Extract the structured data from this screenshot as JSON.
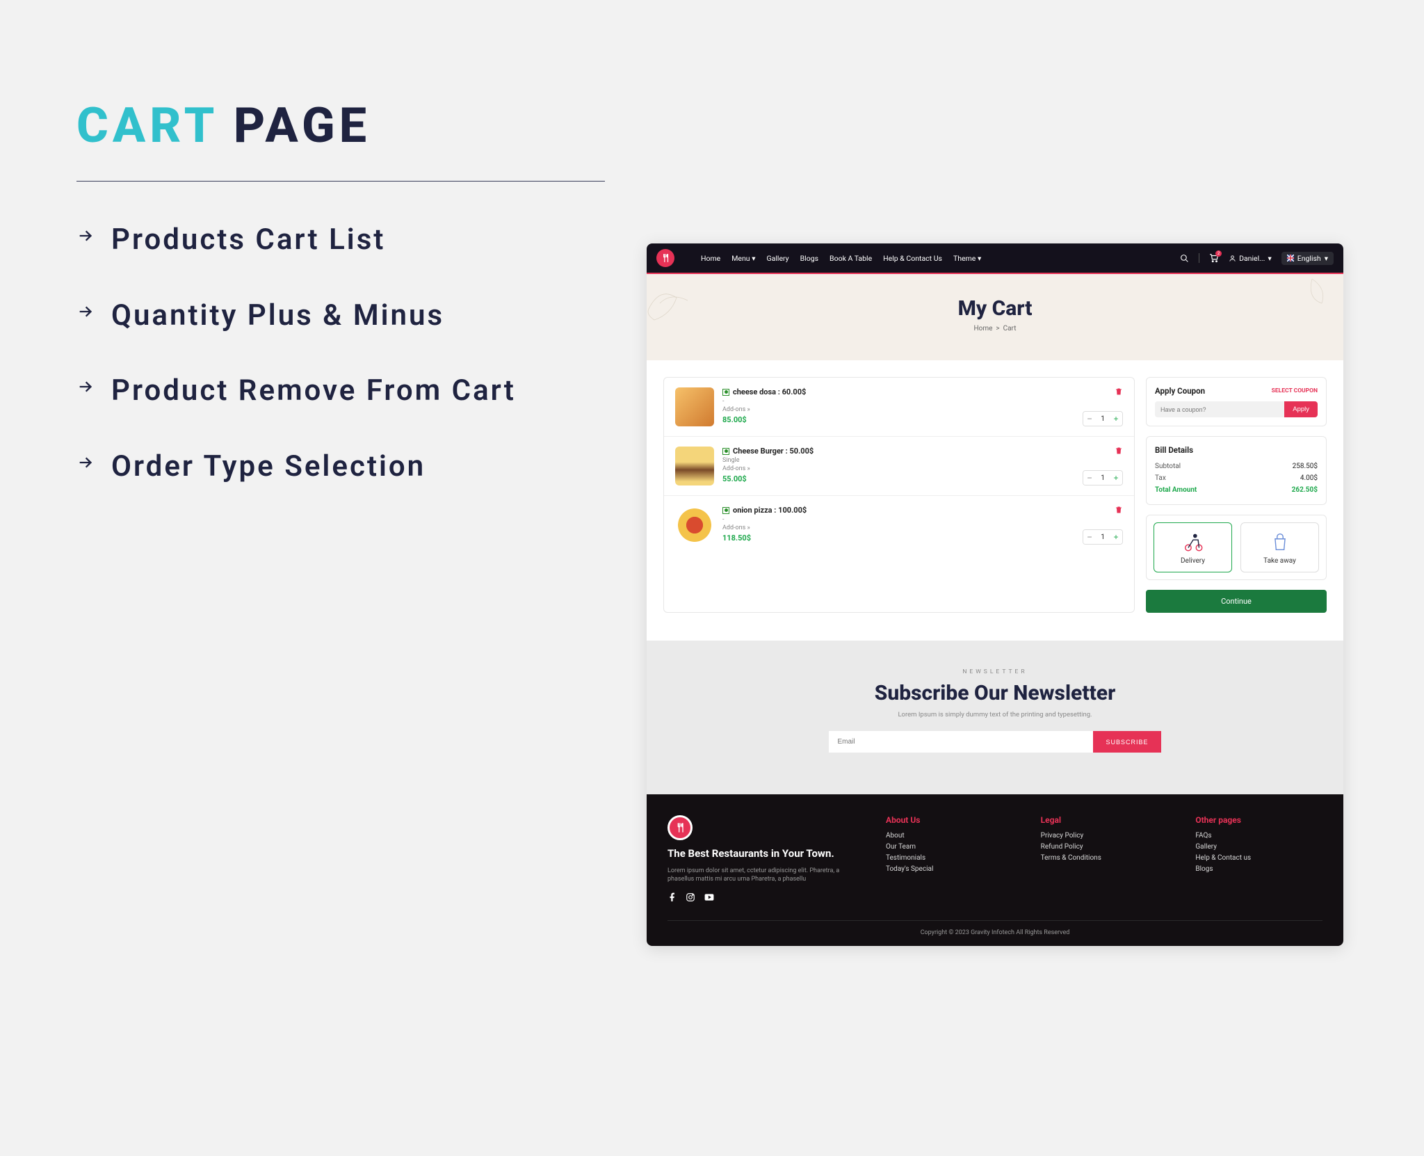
{
  "left": {
    "title_accent": "CART",
    "title_rest": "PAGE",
    "features": [
      "Products Cart List",
      "Quantity Plus & Minus",
      "Product Remove From Cart",
      "Order Type Selection"
    ]
  },
  "nav": {
    "links": [
      "Home",
      "Menu",
      "Gallery",
      "Blogs",
      "Book A Table",
      "Help & Contact Us",
      "Theme"
    ],
    "user": "Daniel...",
    "language": "English",
    "cart_count": "2"
  },
  "hero": {
    "title": "My Cart",
    "breadcrumb_home": "Home",
    "breadcrumb_current": "Cart"
  },
  "cart": {
    "items": [
      {
        "name": "cheese dosa : 60.00$",
        "sub": "-",
        "addon": "Add-ons  »",
        "price": "85.00$",
        "qty": "1"
      },
      {
        "name": "Cheese Burger : 50.00$",
        "sub": "Single",
        "addon": "Add-ons  »",
        "price": "55.00$",
        "qty": "1"
      },
      {
        "name": "onion pizza : 100.00$",
        "sub": "-",
        "addon": "Add-ons  »",
        "price": "118.50$",
        "qty": "1"
      }
    ]
  },
  "coupon": {
    "title": "Apply Coupon",
    "select": "SELECT COUPON",
    "placeholder": "Have a coupon?",
    "apply": "Apply"
  },
  "bill": {
    "title": "Bill Details",
    "rows": [
      {
        "label": "Subtotal",
        "value": "258.50$"
      },
      {
        "label": "Tax",
        "value": "4.00$"
      }
    ],
    "total_label": "Total Amount",
    "total_value": "262.50$"
  },
  "order_types": {
    "delivery": "Delivery",
    "takeaway": "Take away"
  },
  "continue": "Continue",
  "newsletter": {
    "label": "NEWSLETTER",
    "title": "Subscribe Our Newsletter",
    "sub": "Lorem Ipsum is simply dummy text of the printing and typesetting.",
    "placeholder": "Email",
    "button": "SUBSCRIBE"
  },
  "footer": {
    "brand_title": "The Best Restaurants in Your Town.",
    "brand_desc": "Lorem ipsum dolor sit amet, cctetur adipiscing elit. Pharetra, a phasellus mattis mi arcu urna Pharetra, a phasellu",
    "cols": [
      {
        "title": "About Us",
        "links": [
          "About",
          "Our Team",
          "Testimonials",
          "Today's Special"
        ]
      },
      {
        "title": "Legal",
        "links": [
          "Privacy Policy",
          "Refund Policy",
          "Terms & Conditions"
        ]
      },
      {
        "title": "Other pages",
        "links": [
          "FAQs",
          "Gallery",
          "Help & Contact us",
          "Blogs"
        ]
      }
    ],
    "copyright": "Copyright © 2023 Gravity Infotech All Rights Reserved"
  }
}
